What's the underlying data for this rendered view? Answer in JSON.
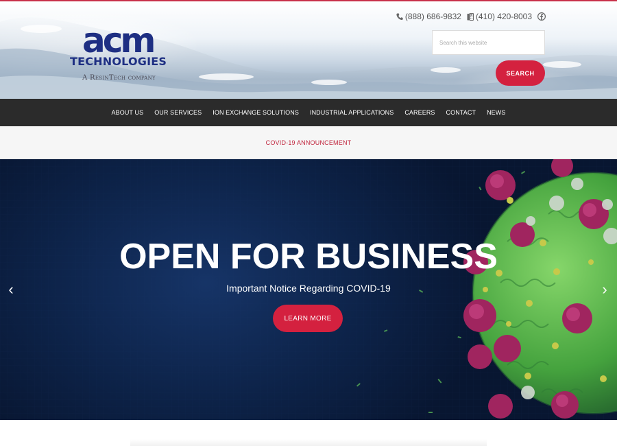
{
  "header": {
    "logo": {
      "main": "acm",
      "name": "TECHNOLOGIES",
      "tagline": "A ResinTech company"
    },
    "contact": {
      "phone": "(888) 686-9832",
      "fax": "(410) 420-8003",
      "icons": [
        "phone-icon",
        "fax-icon",
        "facebook-icon"
      ]
    },
    "search": {
      "placeholder": "Search this website",
      "button_label": "SEARCH"
    },
    "accent_color": "#d4213f"
  },
  "nav": {
    "items": [
      {
        "label": "ABOUT US"
      },
      {
        "label": "OUR SERVICES"
      },
      {
        "label": "ION EXCHANGE SOLUTIONS"
      },
      {
        "label": "INDUSTRIAL APPLICATIONS"
      },
      {
        "label": "CAREERS"
      },
      {
        "label": "CONTACT"
      },
      {
        "label": "NEWS"
      }
    ]
  },
  "announcement": {
    "label": "COVID-19 ANNOUNCEMENT"
  },
  "hero": {
    "title": "OPEN FOR BUSINESS",
    "subtitle": "Important Notice Regarding COVID-19",
    "button_label": "LEARN MORE",
    "prev_label": "‹",
    "next_label": "›"
  }
}
